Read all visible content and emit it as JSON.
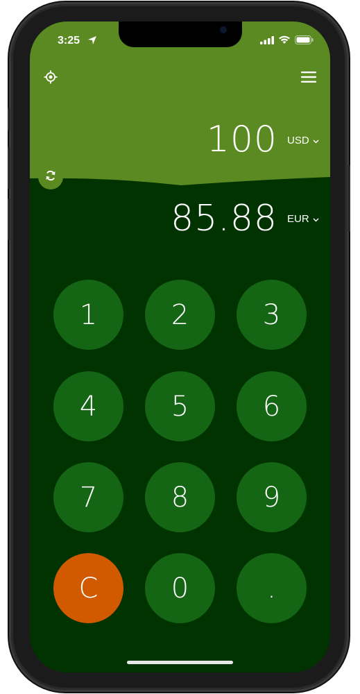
{
  "status_bar": {
    "time": "3:25"
  },
  "converter": {
    "from_amount": "100",
    "from_currency": "USD",
    "to_amount": "85.88",
    "to_currency": "EUR"
  },
  "keypad": {
    "keys": [
      "1",
      "2",
      "3",
      "4",
      "5",
      "6",
      "7",
      "8",
      "9",
      "C",
      "0",
      "."
    ]
  },
  "icons": {
    "location": "crosshair-icon",
    "menu": "hamburger-menu-icon",
    "swap": "swap-icon",
    "dropdown": "chevron-down-icon"
  },
  "colors": {
    "header_green": "#5a8a21",
    "background_dark": "#013301",
    "key_green": "#146514",
    "clear_orange": "#d15a00"
  }
}
